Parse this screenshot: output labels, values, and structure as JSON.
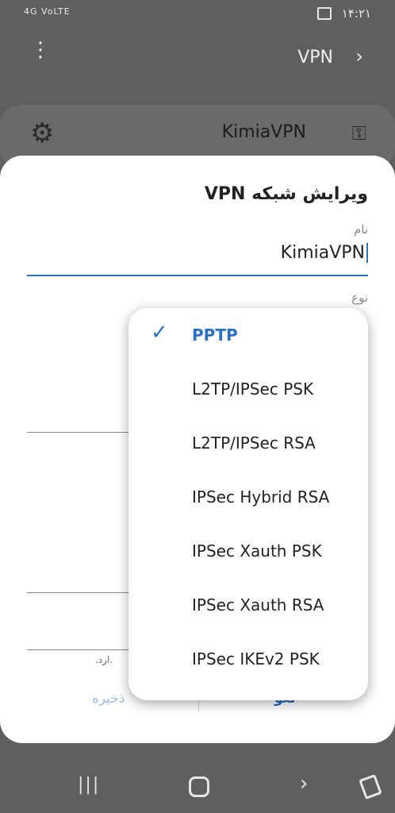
{
  "status": {
    "signal": "4G VoLTE",
    "time": "۱۴:۲۱"
  },
  "appbar": {
    "title": "VPN"
  },
  "vpn_card": {
    "name": "KimiaVPN"
  },
  "dialog": {
    "title": "ویرایش شبکه VPN",
    "name_label": "نام",
    "name_value": "KimiaVPN",
    "type_label": "نوع",
    "hint": ".ارد.",
    "save_label": "ذخیره",
    "cancel_label": "لغو"
  },
  "dropdown": {
    "selected": "PPTP",
    "options": [
      "PPTP",
      "L2TP/IPSec PSK",
      "L2TP/IPSec RSA",
      "IPSec Hybrid RSA",
      "IPSec Xauth PSK",
      "IPSec Xauth RSA",
      "IPSec IKEv2 PSK"
    ]
  }
}
